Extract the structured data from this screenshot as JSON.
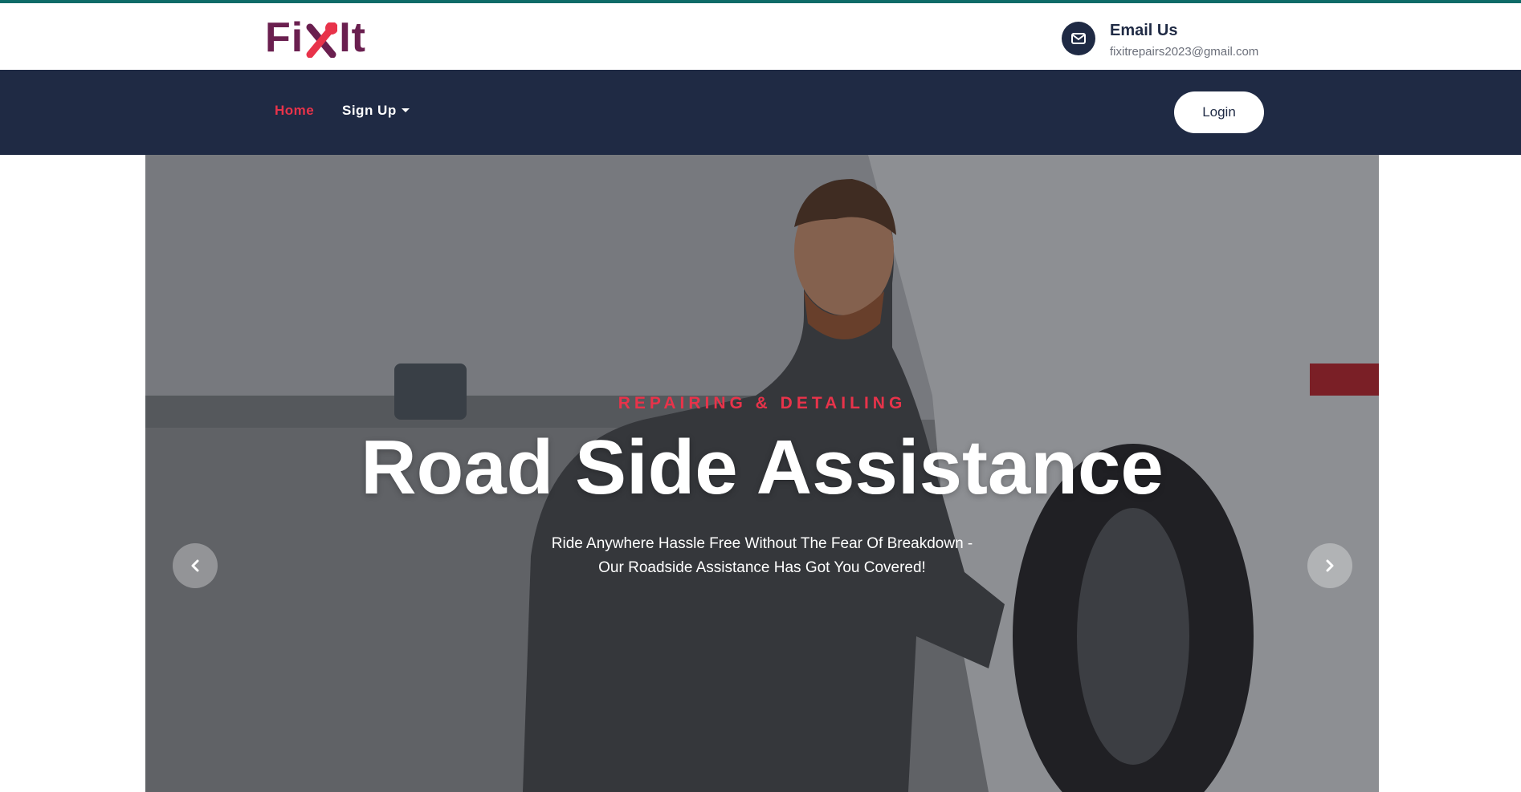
{
  "brand": {
    "name_left": "Fi",
    "name_right": "It",
    "colors": {
      "primary": "#6a1f4f",
      "accent": "#e8334a",
      "navy": "#1f2a44",
      "topline": "#0e6b68"
    },
    "logo_icon": "tools-x-icon"
  },
  "contact": {
    "icon": "envelope-icon",
    "label": "Email Us",
    "email": "fixitrepairs2023@gmail.com"
  },
  "nav": {
    "home_label": "Home",
    "signup_label": "Sign Up",
    "login_label": "Login"
  },
  "hero": {
    "kicker": "REPAIRING & DETAILING",
    "title": "Road Side Assistance",
    "subtitle_line1": "Ride Anywhere Hassle Free Without The Fear Of Breakdown -",
    "subtitle_line2": "Our Roadside Assistance Has Got You Covered!",
    "prev_icon": "chevron-left-icon",
    "next_icon": "chevron-right-icon"
  }
}
